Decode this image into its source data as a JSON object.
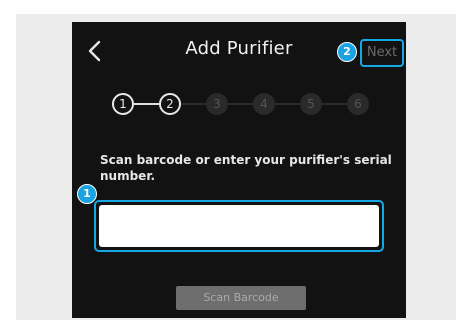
{
  "header": {
    "title": "Add Purifier",
    "next_label": "Next",
    "back_icon": "chevron-left-icon"
  },
  "steps": [
    "1",
    "2",
    "3",
    "4",
    "5",
    "6"
  ],
  "current_step": 2,
  "prompt_text": "Scan barcode or enter your purifier's serial number.",
  "serial_input": {
    "value": "",
    "placeholder": ""
  },
  "scan_button_label": "Scan Barcode",
  "callouts": {
    "serial": "1",
    "next": "2"
  },
  "colors": {
    "screen_bg": "#121212",
    "accent_callout": "#1aa3e0",
    "highlight_border": "#17a8e3",
    "disabled_button": "#6e6e6e"
  }
}
